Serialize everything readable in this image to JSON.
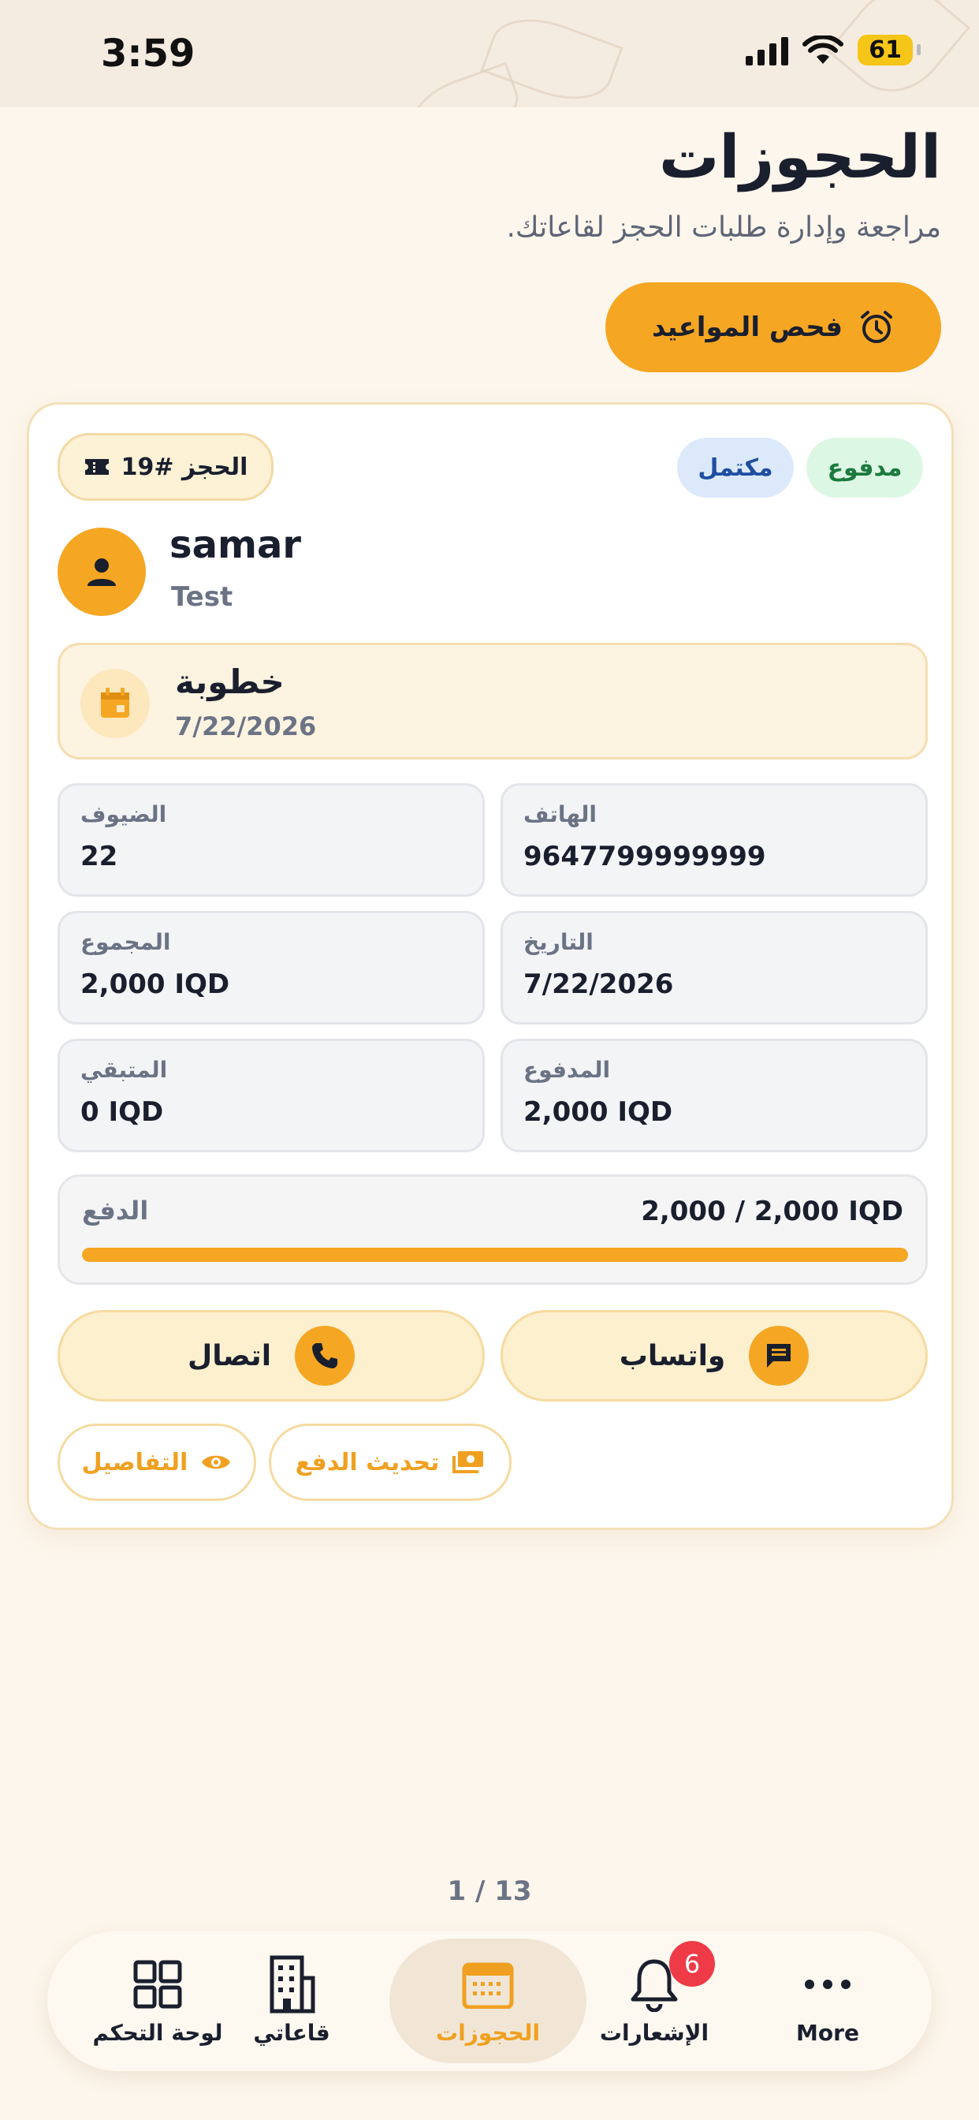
{
  "status_bar": {
    "time": "3:59",
    "battery": "61"
  },
  "header": {
    "title": "الحجوزات",
    "subtitle": "مراجعة وإدارة طلبات الحجز لقاعاتك."
  },
  "check_button": {
    "label": "فحص المواعيد"
  },
  "booking": {
    "number_label": "الحجز #19",
    "badges": {
      "paid": "مدفوع",
      "completed": "مكتمل"
    },
    "customer": {
      "name": "samar",
      "sub": "Test"
    },
    "event": {
      "title": "خطوبة",
      "date": "7/22/2026"
    },
    "info": {
      "phone": {
        "label": "الهاتف",
        "value": "9647799999999"
      },
      "guests": {
        "label": "الضيوف",
        "value": "22"
      },
      "date": {
        "label": "التاريخ",
        "value": "7/22/2026"
      },
      "total": {
        "label": "المجموع",
        "value": "2,000 IQD"
      },
      "paid": {
        "label": "المدفوع",
        "value": "2,000 IQD"
      },
      "remaining": {
        "label": "المتبقي",
        "value": "0 IQD"
      }
    },
    "payment": {
      "label": "الدفع",
      "total_text": "2,000 / 2,000 IQD",
      "progress": 1.0
    },
    "actions": {
      "whatsapp": "واتساب",
      "call": "اتصال",
      "update_payment": "تحديث الدفع",
      "details": "التفاصيل"
    }
  },
  "pager": {
    "text": "1 / 13"
  },
  "tabbar": {
    "items": [
      {
        "label": "More",
        "icon": "more-icon"
      },
      {
        "label": "الإشعارات",
        "icon": "bell-icon",
        "badge": "6"
      },
      {
        "label": "الحجوزات",
        "icon": "calendar-icon",
        "active": true
      },
      {
        "label": "قاعاتي",
        "icon": "building-icon"
      },
      {
        "label": "لوحة التحكم",
        "icon": "dashboard-icon"
      }
    ]
  },
  "colors": {
    "accent": "#f5a623",
    "background": "#fdf6ec",
    "badge": "#ef3b48"
  }
}
